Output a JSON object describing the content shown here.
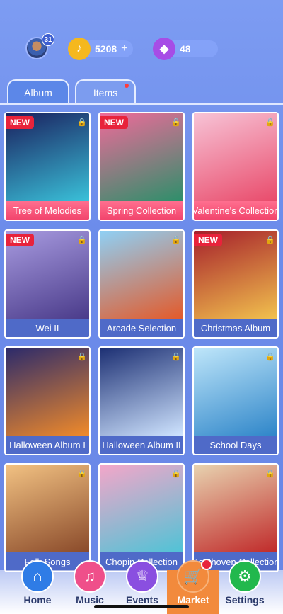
{
  "header": {
    "avatar_badge": "31",
    "coins": "5208",
    "coins_plus": "+",
    "gems": "48"
  },
  "tabs": [
    {
      "label": "Album",
      "active": true
    },
    {
      "label": "Items",
      "active": false,
      "has_dot": true
    }
  ],
  "albums": [
    {
      "title": "Tree of Melodies",
      "new": true,
      "highlight": true,
      "art": [
        "#1a1f5e",
        "#3ac1d9"
      ]
    },
    {
      "title": "Spring Collection",
      "new": true,
      "highlight": true,
      "art": [
        "#f06a9a",
        "#2d8f6a"
      ]
    },
    {
      "title": "Valentine's Collection",
      "new": false,
      "highlight": true,
      "art": [
        "#f7c3d6",
        "#e94b6b"
      ]
    },
    {
      "title": "Wei II",
      "new": true,
      "highlight": false,
      "art": [
        "#a89be0",
        "#4a3b8a"
      ]
    },
    {
      "title": "Arcade Selection",
      "new": false,
      "highlight": false,
      "art": [
        "#8fd0f5",
        "#e35a2a"
      ]
    },
    {
      "title": "Christmas Album",
      "new": true,
      "highlight": false,
      "art": [
        "#a51f2b",
        "#f2c14e"
      ]
    },
    {
      "title": "Halloween Album I",
      "new": false,
      "highlight": false,
      "art": [
        "#2b2a6b",
        "#f08a2a"
      ]
    },
    {
      "title": "Halloween Album II",
      "new": false,
      "highlight": false,
      "art": [
        "#1c2f73",
        "#cfe4ff"
      ]
    },
    {
      "title": "School Days",
      "new": false,
      "highlight": false,
      "art": [
        "#bfe6fa",
        "#2f86c9"
      ]
    },
    {
      "title": "Folk Songs",
      "new": false,
      "highlight": false,
      "art": [
        "#f2c283",
        "#8a4a2a"
      ]
    },
    {
      "title": "Chopin Collection",
      "new": false,
      "highlight": false,
      "art": [
        "#f4a6c9",
        "#4fc3d6"
      ]
    },
    {
      "title": "Beethoven Collection",
      "new": false,
      "highlight": false,
      "art": [
        "#e8d3b0",
        "#c02a2a"
      ]
    }
  ],
  "new_label": "NEW",
  "nav": [
    {
      "label": "Home",
      "icon": "home-icon",
      "color": "#2f7ce6"
    },
    {
      "label": "Music",
      "icon": "music-note-icon",
      "color": "#ef4f8a"
    },
    {
      "label": "Events",
      "icon": "trophy-icon",
      "color": "#8a4fe0"
    },
    {
      "label": "Market",
      "icon": "cart-icon",
      "color": "#f28a3c"
    },
    {
      "label": "Settings",
      "icon": "gear-icon",
      "color": "#22b84d"
    }
  ]
}
